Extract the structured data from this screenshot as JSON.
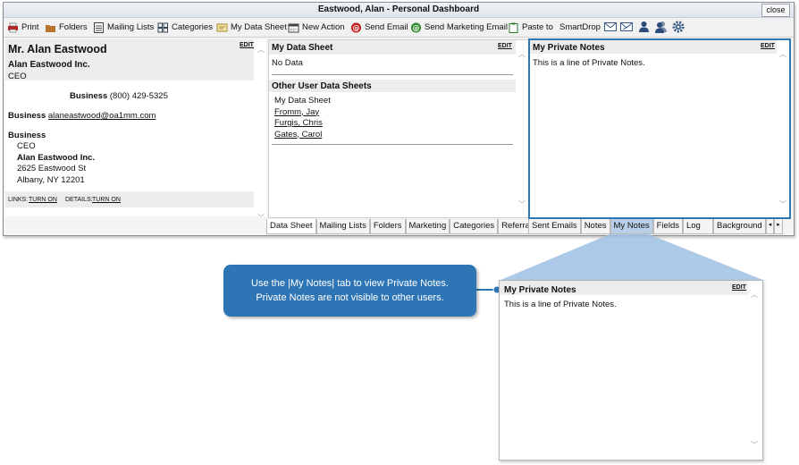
{
  "window": {
    "title": "Eastwood, Alan - Personal Dashboard",
    "close_label": "close"
  },
  "toolbar": {
    "print": "Print",
    "folders": "Folders",
    "mailing_lists": "Mailing Lists",
    "categories": "Categories",
    "my_data_sheet": "My Data Sheet",
    "new_action": "New Action",
    "send_email": "Send Email",
    "send_marketing_email": "Send Marketing Email",
    "paste_to": "Paste to",
    "smartdrop": "SmartDrop"
  },
  "contact": {
    "name": "Mr. Alan Eastwood",
    "edit": "EDIT",
    "company": "Alan Eastwood Inc.",
    "title": "CEO",
    "phone_label": "Business",
    "phone": "(800) 429-5325",
    "email_label": "Business",
    "email": "alaneastwood@oa1mm.com",
    "address_label": "Business",
    "address_lines": [
      "CEO",
      "Alan Eastwood Inc.",
      "2625 Eastwood St",
      "Albany, NY 12201"
    ],
    "links_label": "LINKS:",
    "links_action": "TURN ON",
    "details_label": "DETAILS:",
    "details_action": "TURN ON"
  },
  "datasheet": {
    "title": "My Data Sheet",
    "edit": "EDIT",
    "value": "No Data",
    "other_title": "Other User Data Sheets",
    "other_items": [
      "My Data Sheet",
      "Fromm, Jay",
      "Furgis, Chris",
      "Gates, Carol"
    ]
  },
  "notes": {
    "title": "My Private Notes",
    "edit": "EDIT",
    "text": "This is a line of Private Notes."
  },
  "tabs_middle": [
    "Data Sheet",
    "Mailing Lists",
    "Folders",
    "Marketing",
    "Categories",
    "Referrals"
  ],
  "tabs_right": [
    "Sent Emails",
    "Notes",
    "My Notes",
    "Fields",
    "Log",
    "Background"
  ],
  "callout": {
    "text_line1": "Use the |My Notes| tab to view Private Notes.",
    "text_line2": "Private Notes are not visible to other users."
  },
  "zoom_panel": {
    "title": "My Private Notes",
    "edit": "EDIT",
    "text": "This is a line of Private Notes."
  }
}
